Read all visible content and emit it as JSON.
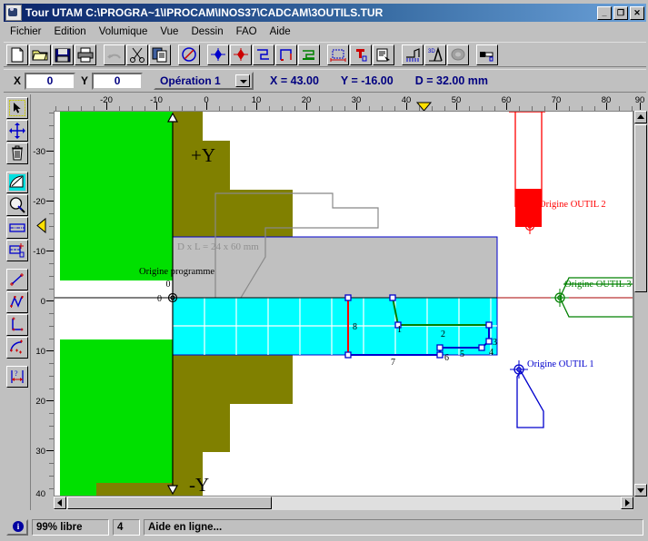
{
  "window": {
    "title": "Tour UTAM  C:\\PROGRA~1\\IPROCAM\\INOS37\\CADCAM\\3OUTILS.TUR",
    "minimize": "_",
    "maximize": "❐",
    "close": "✕"
  },
  "menu": [
    "Fichier",
    "Edition",
    "Volumique",
    "Vue",
    "Dessin",
    "FAO",
    "Aide"
  ],
  "toolbar": {
    "icons": [
      "new-file-icon",
      "open-folder-icon",
      "save-disk-icon",
      "print-icon",
      "undo-icon",
      "cut-scissors-icon",
      "copy-icon",
      "circle-tool-icon",
      "point-blue-icon",
      "point-red-icon",
      "contour-blue-icon",
      "pocket-icon",
      "face-green-icon",
      "stock-dims-icon",
      "tool-red-icon",
      "properties-icon",
      "section-icon",
      "3d-view-icon",
      "render-icon",
      "simulate-icon"
    ]
  },
  "coords_bar": {
    "x_label": "X",
    "x_value": "0",
    "y_label": "Y",
    "y_value": "0",
    "operation": "Opération 1",
    "readout_x": "X = 43.00",
    "readout_y": "Y = -16.00",
    "readout_d": "D = 32.00 mm"
  },
  "left_tools": [
    {
      "name": "select-arrow-icon"
    },
    {
      "name": "pan-move-icon"
    },
    {
      "name": "delete-trash-icon"
    },
    {
      "name": "shade-fill-icon"
    },
    {
      "name": "zoom-magnifier-icon"
    },
    {
      "name": "stock-rect-icon"
    },
    {
      "name": "origin-set-icon"
    },
    {
      "name": "line-segment-icon"
    },
    {
      "name": "polyline-icon"
    },
    {
      "name": "corner-icon"
    },
    {
      "name": "arc-icon"
    },
    {
      "name": "dimension-icon"
    }
  ],
  "rulers": {
    "horizontal": [
      "-20",
      "-10",
      "0",
      "10",
      "20",
      "30",
      "40",
      "50",
      "60",
      "70",
      "80",
      "90"
    ],
    "vertical": [
      "-30",
      "-20",
      "-10",
      "0",
      "10",
      "20",
      "30",
      "40"
    ],
    "h_cursor_value": "43",
    "v_cursor_value": "-16"
  },
  "drawing": {
    "stock_label": "D x L = 24 x 60 mm",
    "origin_program_label": "Origine programme",
    "origin_program_x": "0",
    "origin_program_y": "0",
    "axis_plus_y": "+Y",
    "axis_minus_y": "-Y",
    "tool_origins": [
      {
        "label": "Origine OUTIL 1",
        "color": "#0000cc"
      },
      {
        "label": "Origine OUTIL 2",
        "color": "#ee0000"
      },
      {
        "label": "Origine OUTIL 3",
        "color": "#008000"
      }
    ],
    "toolpath_segments": [
      "1",
      "2",
      "3",
      "4",
      "5",
      "6",
      "7",
      "8"
    ],
    "colors": {
      "stock_green": "#00e000",
      "material_olive": "#808000",
      "part_gray": "#c0c0c0",
      "machined_cyan": "#00ffff",
      "path_blue": "#0000cc",
      "path_green": "#008000",
      "path_red": "#ff0000",
      "cursor_yellow": "#ffe000"
    }
  },
  "status": {
    "info_icon": "info-icon",
    "memory": "99% libre",
    "count": "4",
    "help": "Aide en ligne..."
  }
}
